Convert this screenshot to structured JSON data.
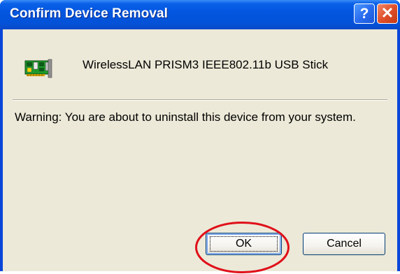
{
  "window": {
    "title": "Confirm Device Removal",
    "help_label": "?",
    "close_label": "✕"
  },
  "device": {
    "name": "WirelessLAN PRISM3 IEEE802.11b USB Stick",
    "icon": "network-card-icon"
  },
  "message": {
    "warning": "Warning: You are about to uninstall this device from your system."
  },
  "buttons": {
    "ok_label": "OK",
    "cancel_label": "Cancel"
  },
  "colors": {
    "titlebar": "#0356e0",
    "dialog_background": "#ece9d8",
    "highlight_circle": "#e0101a"
  }
}
